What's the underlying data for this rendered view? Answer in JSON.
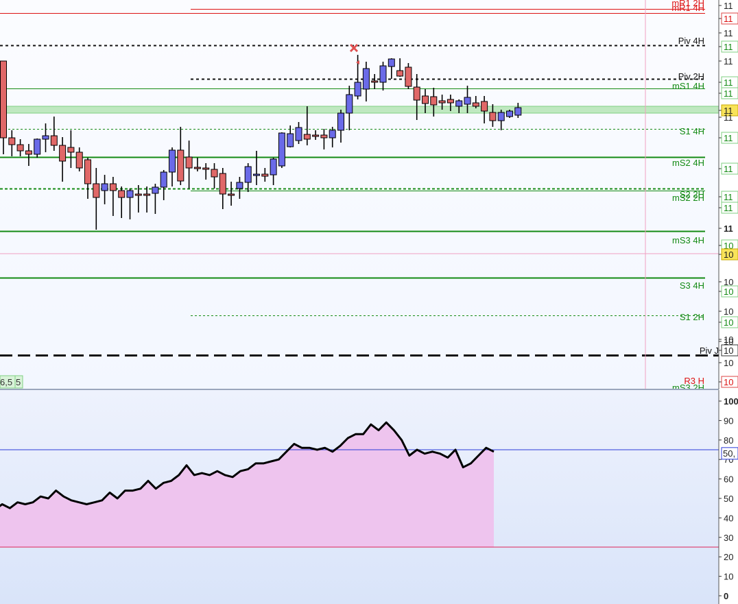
{
  "colors": {
    "bull": "#6a6ae8",
    "bear": "#e06868",
    "resistance": "#dd1111",
    "support": "#138a13",
    "pivot": "#111111",
    "zone": "#bfe8c0",
    "rsi_fill": "#eec4ee",
    "rsi_line": "#000000",
    "bg_top": "#fbfcff",
    "bg_bottom": "#d8e3f8"
  },
  "chart_data": [
    {
      "type": "candlestick",
      "ohlc": [
        [
          89,
          178,
          225,
          201
        ],
        [
          201,
          190,
          228,
          211
        ],
        [
          211,
          203,
          228,
          220
        ],
        [
          220,
          210,
          242,
          225
        ],
        [
          225,
          202,
          230,
          203
        ],
        [
          203,
          180,
          222,
          198
        ],
        [
          198,
          170,
          220,
          212
        ],
        [
          212,
          200,
          265,
          235
        ],
        [
          215,
          190,
          245,
          222
        ],
        [
          222,
          215,
          250,
          245
        ],
        [
          233,
          230,
          290,
          268
        ],
        [
          268,
          245,
          335,
          288
        ],
        [
          278,
          255,
          298,
          268
        ],
        [
          268,
          258,
          315,
          278
        ],
        [
          278,
          272,
          318,
          288
        ],
        [
          288,
          275,
          320,
          278
        ],
        [
          283,
          270,
          310,
          283
        ],
        [
          283,
          272,
          310,
          283
        ],
        [
          282,
          268,
          312,
          273
        ],
        [
          273,
          248,
          292,
          251
        ],
        [
          251,
          215,
          272,
          219
        ],
        [
          219,
          185,
          270,
          264
        ],
        [
          229,
          205,
          275,
          245
        ],
        [
          244,
          230,
          250,
          246
        ],
        [
          245,
          238,
          262,
          247
        ],
        [
          247,
          238,
          275,
          258
        ],
        [
          253,
          245,
          305,
          283
        ],
        [
          283,
          265,
          300,
          283
        ],
        [
          275,
          258,
          290,
          266
        ],
        [
          266,
          238,
          280,
          243
        ],
        [
          256,
          220,
          270,
          254
        ],
        [
          254,
          245,
          265,
          257
        ],
        [
          255,
          230,
          270,
          232
        ],
        [
          242,
          193,
          245,
          194
        ],
        [
          214,
          183,
          215,
          195
        ],
        [
          205,
          178,
          210,
          186
        ],
        [
          196,
          155,
          212,
          203
        ],
        [
          197,
          190,
          204,
          197
        ],
        [
          197,
          188,
          218,
          201
        ],
        [
          201,
          185,
          215,
          190
        ],
        [
          190,
          160,
          208,
          165
        ],
        [
          165,
          125,
          190,
          138
        ],
        [
          140,
          80,
          145,
          120
        ],
        [
          130,
          90,
          148,
          100
        ],
        [
          118,
          108,
          130,
          120
        ],
        [
          120,
          90,
          132,
          96
        ],
        [
          97,
          85,
          115,
          86
        ],
        [
          103,
          85,
          112,
          111
        ],
        [
          98,
          92,
          130,
          126
        ],
        [
          127,
          108,
          175,
          146
        ],
        [
          140,
          130,
          165,
          151
        ],
        [
          141,
          128,
          170,
          153
        ],
        [
          147,
          138,
          160,
          150
        ],
        [
          145,
          138,
          162,
          150
        ],
        [
          155,
          145,
          165,
          147
        ],
        [
          152,
          125,
          165,
          142
        ],
        [
          150,
          140,
          158,
          155
        ],
        [
          148,
          140,
          180,
          162
        ],
        [
          164,
          152,
          185,
          176
        ],
        [
          176,
          160,
          190,
          164
        ],
        [
          170,
          160,
          172,
          162
        ],
        [
          168,
          150,
          172,
          157
        ]
      ],
      "right_labels": [
        {
          "name": "mR1 2H",
          "kind": "resistance",
          "price": 113.55
        },
        {
          "name": "mR1 4H",
          "kind": "resistance",
          "price": 113.49
        },
        {
          "name": "Piv 4H",
          "kind": "pivot",
          "price": 113.04
        },
        {
          "name": "Piv 2H",
          "kind": "pivot",
          "price": 112.57
        },
        {
          "name": "mS1 4H",
          "kind": "support",
          "price": 112.43
        },
        {
          "name": "S1 4H",
          "kind": "support",
          "price": 111.87
        },
        {
          "name": "mS2 4H",
          "kind": "support",
          "price": 111.47
        },
        {
          "name": "S2 2H",
          "kind": "support",
          "price": 111.03
        },
        {
          "name": "mS2 2H",
          "kind": "support",
          "price": 111.0
        },
        {
          "name": "mS3 4H",
          "kind": "support",
          "price": 110.44
        },
        {
          "name": "S3 4H",
          "kind": "support",
          "price": 109.78
        },
        {
          "name": "S1 2H",
          "kind": "support",
          "price": 109.26
        },
        {
          "name": "Piv J",
          "kind": "pivot",
          "price": 108.7
        },
        {
          "name": "R3 H",
          "kind": "resistance",
          "price": 108.2
        },
        {
          "name": "mS3 2H",
          "kind": "support",
          "price": 108.14
        }
      ],
      "price_axis_ticks": [
        "11",
        "11",
        "11",
        "11",
        "11",
        "11",
        "11",
        "11",
        "11",
        "11",
        "11",
        "11",
        "11",
        "11",
        "10",
        "10",
        "10",
        "10",
        "10",
        "10",
        "10",
        "10",
        "10",
        "10",
        "10"
      ],
      "badges": [
        "6,5",
        "5"
      ]
    },
    {
      "type": "area",
      "y": [
        44,
        47,
        45,
        48,
        47,
        48,
        51,
        50,
        54,
        51,
        49,
        48,
        47,
        48,
        49,
        53,
        50,
        54,
        54,
        55,
        59,
        55,
        58,
        59,
        62,
        67,
        62,
        63,
        62,
        64,
        62,
        61,
        64,
        65,
        68,
        68,
        69,
        70,
        74,
        78,
        76,
        76,
        75,
        76,
        74,
        77,
        81,
        83,
        83,
        88,
        85,
        89,
        85,
        80,
        72,
        75,
        73,
        74,
        73,
        71,
        75,
        66,
        68,
        72,
        76,
        74
      ],
      "ylim": [
        0,
        100
      ],
      "y_ticks": [
        "100",
        "90",
        "80",
        "70",
        "60",
        "50",
        "40",
        "30",
        "20",
        "10",
        "0"
      ],
      "levels": [
        75,
        25
      ],
      "last_value_label": "50,"
    }
  ]
}
